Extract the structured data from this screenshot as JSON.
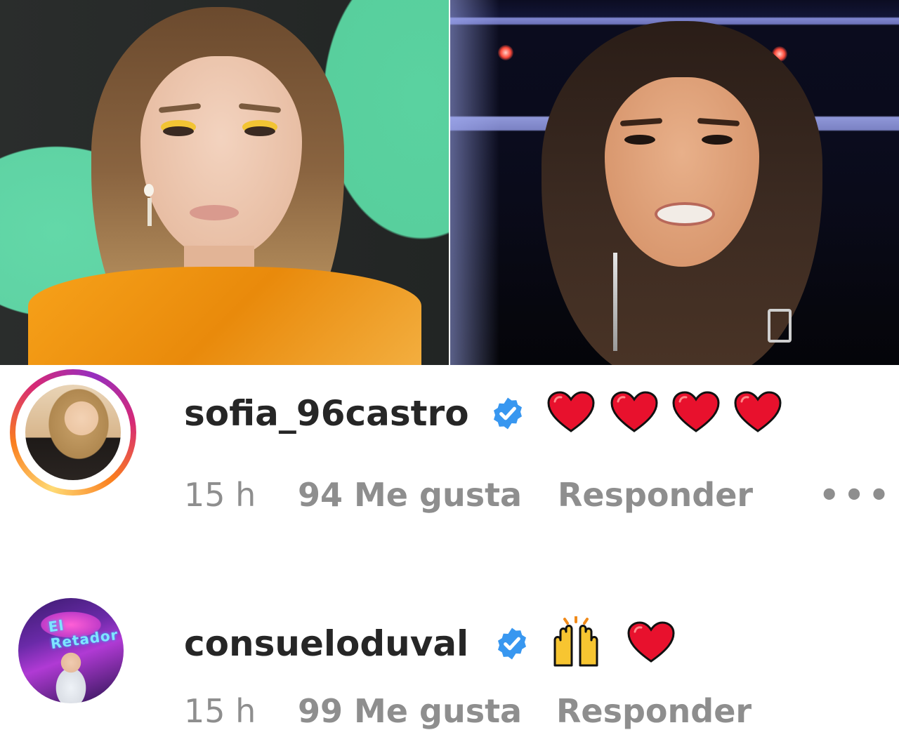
{
  "comments": [
    {
      "username": "sofia_96castro",
      "verified": true,
      "emojis": [
        "red-heart",
        "red-heart",
        "red-heart",
        "red-heart"
      ],
      "time": "15 h",
      "likes": "94 Me gusta",
      "reply": "Responder",
      "more": "•••",
      "story_ring": true
    },
    {
      "username": "consueloduval",
      "verified": true,
      "emojis": [
        "raising-hands",
        "red-heart"
      ],
      "time": "15 h",
      "likes": "99 Me gusta",
      "reply": "Responder",
      "avatar_sign": "El Retador",
      "story_ring": false
    }
  ],
  "colors": {
    "username": "#262626",
    "meta": "#8e8e8e",
    "verified_badge": "#3897f0",
    "heart": "#e8112d",
    "story_ring": [
      "#feda75",
      "#fa7e1e",
      "#d62976",
      "#962fbf"
    ]
  }
}
